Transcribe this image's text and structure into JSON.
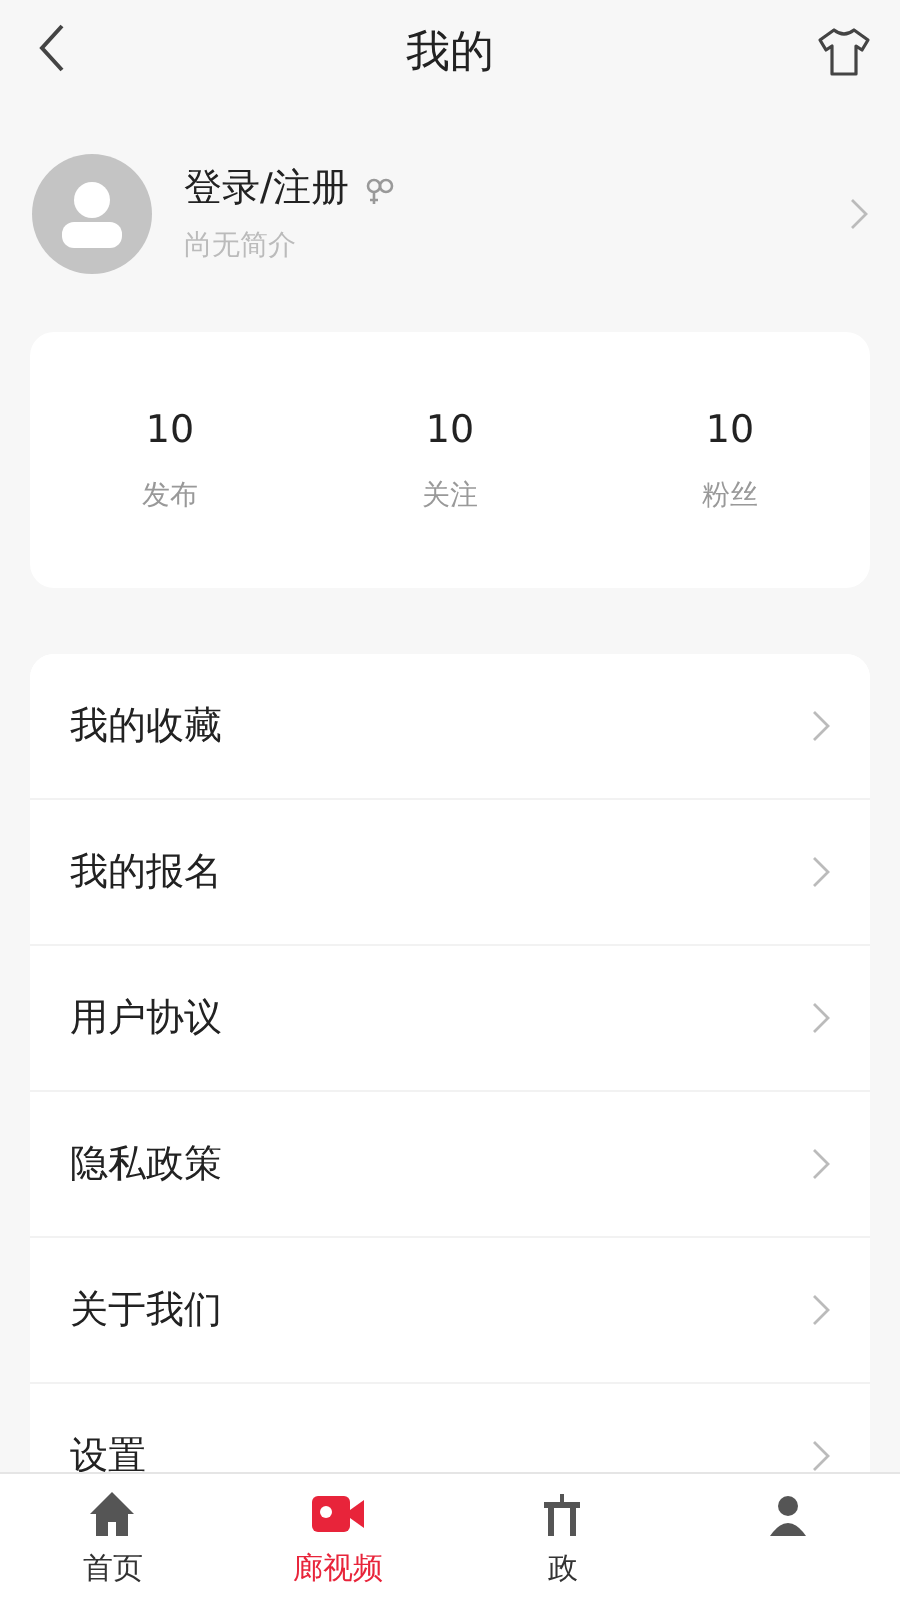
{
  "header": {
    "title": "我的"
  },
  "profile": {
    "name": "登录/注册",
    "bio": "尚无简介"
  },
  "stats": [
    {
      "value": "10",
      "label": "发布"
    },
    {
      "value": "10",
      "label": "关注"
    },
    {
      "value": "10",
      "label": "粉丝"
    }
  ],
  "menu": [
    {
      "label": "我的收藏"
    },
    {
      "label": "我的报名"
    },
    {
      "label": "用户协议"
    },
    {
      "label": "隐私政策"
    },
    {
      "label": "关于我们"
    },
    {
      "label": "设置"
    }
  ],
  "tabbar": [
    {
      "kind": "home",
      "label": "首页",
      "selected": false
    },
    {
      "kind": "video",
      "label": "廊视频",
      "selected": true
    },
    {
      "kind": "policy",
      "label": "政",
      "selected": false
    },
    {
      "kind": "user",
      "selected": false
    }
  ]
}
